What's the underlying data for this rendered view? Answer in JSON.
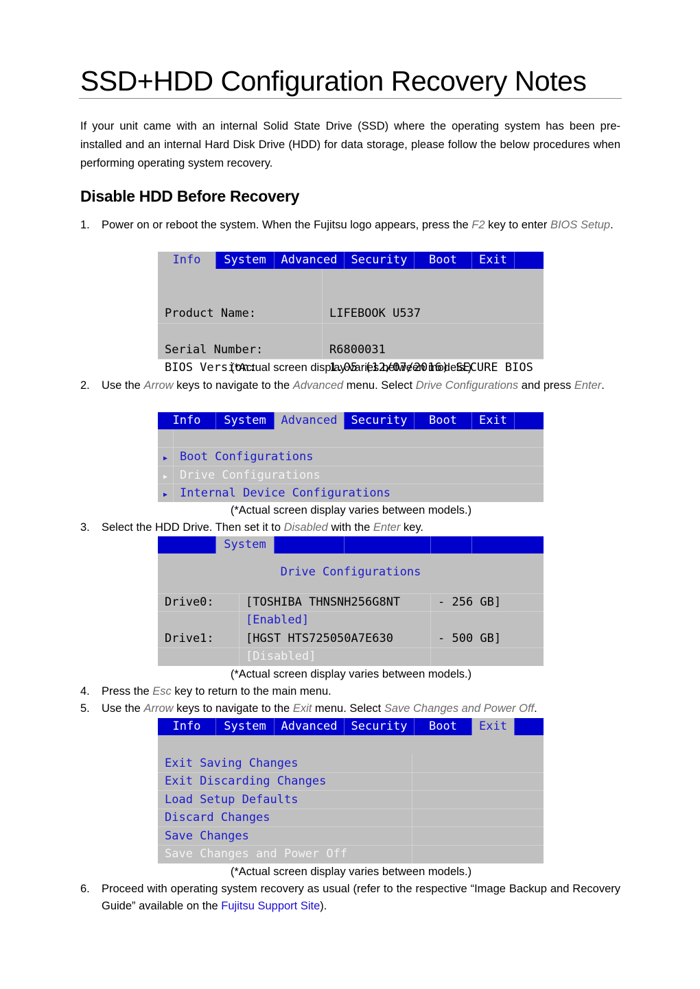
{
  "title": "SSD+HDD Configuration Recovery Notes",
  "intro": "If your unit came with an internal Solid State Drive (SSD) where the operating system has been pre-installed and an internal Hard Disk Drive (HDD) for data storage, please follow the below procedures when performing operating system recovery.",
  "section_heading": "Disable HDD Before Recovery",
  "caption": "(*Actual screen display varies between models.)",
  "steps": [
    {
      "num": "1.",
      "parts": [
        "Power on or reboot the system. When the Fujitsu logo appears, press the ",
        "F2",
        " key to enter ",
        "BIOS Setup",
        "."
      ]
    },
    {
      "num": "2.",
      "parts": [
        "Use the ",
        "Arrow",
        " keys to navigate to the ",
        "Advanced",
        " menu. Select ",
        "Drive Configurations",
        " and press ",
        "Enter",
        "."
      ]
    },
    {
      "num": "3.",
      "parts": [
        "Select the HDD Drive. Then set it to ",
        "Disabled",
        " with the ",
        "Enter",
        " key."
      ]
    },
    {
      "num": "4.",
      "parts": [
        "Press the ",
        "Esc",
        " key to return to the main menu."
      ]
    },
    {
      "num": "5.",
      "parts": [
        "Use the ",
        "Arrow",
        " keys to navigate to the ",
        "Exit",
        " menu. Select ",
        "Save Changes and Power Off",
        "."
      ]
    },
    {
      "num": "6.",
      "parts": [
        "Proceed with operating system recovery as usual (refer to the respective “Image Backup and Recovery Guide” available on the ",
        "Fujitsu Support Site",
        ")."
      ]
    }
  ],
  "bios_tabs": [
    "Info",
    "System",
    "Advanced",
    "Security",
    "Boot",
    "Exit"
  ],
  "bios_info": {
    "active_tab": "Info",
    "rows": [
      {
        "label": "Product Name:",
        "value": "LIFEBOOK U537"
      },
      {
        "label": "Serial Number:",
        "value": "R6800031"
      },
      {
        "label": "BIOS Version:",
        "value": "1.05 (12/07/2016) SECURE BIOS"
      }
    ]
  },
  "bios_advanced": {
    "active_tab": "Advanced",
    "items": [
      {
        "label": "Boot Configurations",
        "selected": false
      },
      {
        "label": "Drive Configurations",
        "selected": true
      },
      {
        "label": "Internal Device Configurations",
        "selected": false
      }
    ]
  },
  "bios_drives": {
    "active_tab": "System",
    "heading": "Drive Configurations",
    "drives": [
      {
        "label": "Drive0:",
        "model": "[TOSHIBA THNSNH256G8NT",
        "size": "- 256 GB]",
        "state": "[Enabled]"
      },
      {
        "label": "Drive1:",
        "model": "[HGST HTS725050A7E630",
        "size": "- 500 GB]",
        "state": "[Disabled]"
      }
    ]
  },
  "bios_exit": {
    "active_tab": "Exit",
    "items": [
      {
        "label": "Exit Saving Changes",
        "selected": false
      },
      {
        "label": "Exit Discarding Changes",
        "selected": false
      },
      {
        "label": "Load Setup Defaults",
        "selected": false
      },
      {
        "label": "Discard Changes",
        "selected": false
      },
      {
        "label": "Save Changes",
        "selected": false
      },
      {
        "label": "Save Changes and Power Off",
        "selected": true
      }
    ]
  },
  "colors": {
    "bios_blue": "#0000cc",
    "bios_gray": "#c0c0c0",
    "link": "#1a0dcc",
    "emphasis": "#6b6b6b"
  }
}
